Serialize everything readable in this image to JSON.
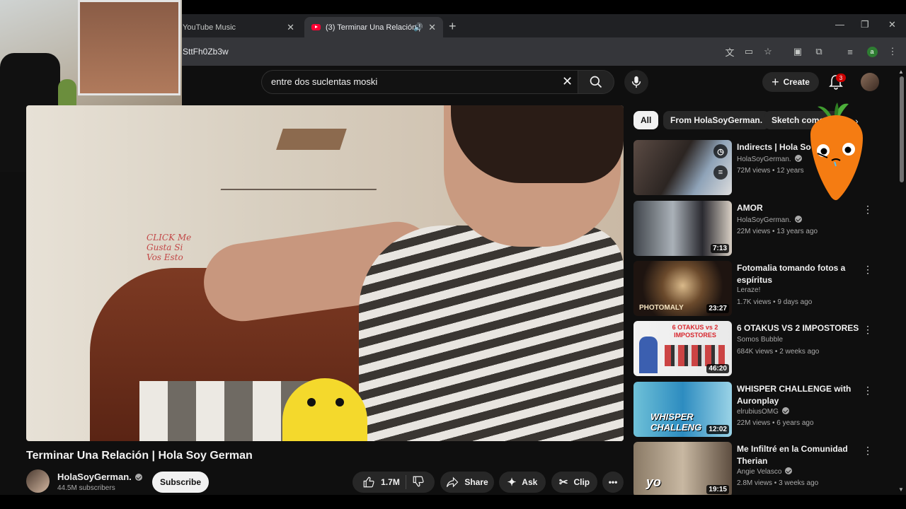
{
  "browser": {
    "tabs": [
      {
        "title": "YouTube Music",
        "active": false
      },
      {
        "title": "(3) Terminar Una Relación |",
        "active": true
      }
    ],
    "url": "SttFh0Zb3w"
  },
  "header": {
    "search_value": "entre dos suclentas moski",
    "create_label": "Create",
    "notification_count": "3"
  },
  "video": {
    "title": "Terminar Una Relación | Hola Soy German",
    "wall_text": "CLICK Me Gusta Si Vos Esto",
    "channel": "HolaSoyGerman.",
    "subscribers": "44.5M subscribers",
    "subscribe_label": "Subscribe",
    "likes": "1.7M",
    "share_label": "Share",
    "ask_label": "Ask",
    "clip_label": "Clip"
  },
  "chips": [
    "All",
    "From HolaSoyGerman.",
    "Sketch comedy"
  ],
  "recommendations": [
    {
      "title": "Indirects | Hola So",
      "channel": "HolaSoyGerman.",
      "verified": true,
      "meta": "72M views • 12 years",
      "duration": "",
      "overlay": ""
    },
    {
      "title": "AMOR",
      "channel": "HolaSoyGerman.",
      "verified": true,
      "meta": "22M views • 13 years ago",
      "duration": "7:13",
      "overlay": ""
    },
    {
      "title": "Fotomalia tomando fotos a espíritus",
      "channel": "Leraze!",
      "verified": false,
      "meta": "1.7K views • 9 days ago",
      "duration": "23:27",
      "overlay": "PHOTOMALY"
    },
    {
      "title": "6 OTAKUS VS 2 IMPOSTORES",
      "channel": "Somos Bubble",
      "verified": false,
      "meta": "684K views • 2 weeks ago",
      "duration": "46:20",
      "overlay": "6 OTAKUS vs 2 IMPOSTORES"
    },
    {
      "title": "WHISPER CHALLENGE with Auronplay",
      "channel": "elrubiusOMG",
      "verified": true,
      "meta": "22M views • 6 years ago",
      "duration": "12:02",
      "overlay": "WHISPER CHALLENG"
    },
    {
      "title": "Me Infiltré en la Comunidad Therian",
      "channel": "Angie Velasco",
      "verified": true,
      "meta": "2.8M views • 3 weeks ago",
      "duration": "19:15",
      "overlay": "yo"
    }
  ],
  "colors": {
    "background": "#0f0f0f",
    "accent_red": "#ff0033",
    "chip_active": "#f1f1f1"
  }
}
